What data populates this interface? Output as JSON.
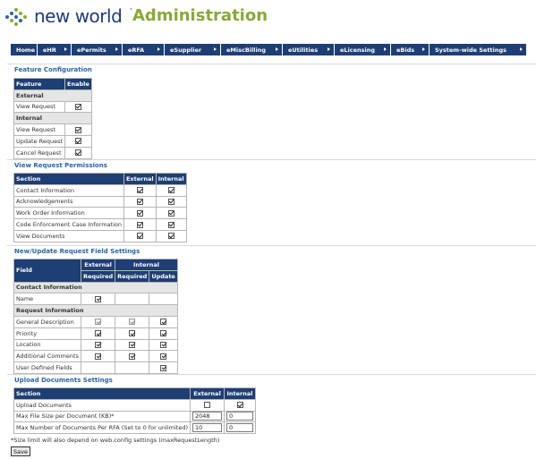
{
  "header": {
    "brand": "new world",
    "trademark": "™",
    "app_title": "Administration"
  },
  "nav": {
    "items": [
      "Home",
      "eHR",
      "ePermits",
      "eRFA",
      "eSupplier",
      "eMiscBilling",
      "eUtilities",
      "eLicensing",
      "eBids",
      "System-wide Settings"
    ]
  },
  "feature_config": {
    "title": "Feature Configuration",
    "headers": [
      "Feature",
      "Enable"
    ],
    "external_group": "External",
    "internal_group": "Internal",
    "external_rows": [
      {
        "label": "View Request",
        "enabled": true
      }
    ],
    "internal_rows": [
      {
        "label": "View Request",
        "enabled": true
      },
      {
        "label": "Update Request",
        "enabled": true
      },
      {
        "label": "Cancel Request",
        "enabled": true
      }
    ]
  },
  "view_permissions": {
    "title": "View Request Permissions",
    "headers": [
      "Section",
      "External",
      "Internal"
    ],
    "rows": [
      {
        "label": "Contact Information",
        "external": true,
        "internal": true
      },
      {
        "label": "Acknowledgements",
        "external": true,
        "internal": true
      },
      {
        "label": "Work Order Information",
        "external": true,
        "internal": true
      },
      {
        "label": "Code Enforcement Case Information",
        "external": true,
        "internal": true
      },
      {
        "label": "View Documents",
        "external": true,
        "internal": true
      }
    ]
  },
  "field_settings": {
    "title": "New/Update Request Field Settings",
    "header_field": "Field",
    "header_external": "External",
    "header_internal": "Internal",
    "header_required": "Required",
    "header_update": "Update",
    "contact_group": "Contact Information",
    "request_group": "Request Information",
    "contact_rows": [
      {
        "label": "Name",
        "ext_req": true,
        "int_req": null,
        "int_upd": null
      }
    ],
    "request_rows": [
      {
        "label": "General Description",
        "ext_req": true,
        "int_req": true,
        "int_upd": true
      },
      {
        "label": "Priority",
        "ext_req": true,
        "int_req": true,
        "int_upd": true
      },
      {
        "label": "Location",
        "ext_req": true,
        "int_req": true,
        "int_upd": true
      },
      {
        "label": "Additional Comments",
        "ext_req": true,
        "int_req": true,
        "int_upd": true
      },
      {
        "label": "User Defined Fields",
        "ext_req": null,
        "int_req": null,
        "int_upd": true
      }
    ]
  },
  "upload_settings": {
    "title": "Upload Documents Settings",
    "headers": [
      "Section",
      "External",
      "Internal"
    ],
    "upload_label": "Upload Documents",
    "upload_external": false,
    "upload_internal": true,
    "max_size_label": "Max File Size per Document (KB)*",
    "max_size_external": "2048",
    "max_size_internal": "0",
    "max_docs_label": "Max Number of Documents Per RFA (Set to 0 for unlimited)",
    "max_docs_external": "10",
    "max_docs_internal": "0"
  },
  "footnote": "*Size limit will also depend on web.config settings (maxRequestLength)",
  "save_label": "Save"
}
